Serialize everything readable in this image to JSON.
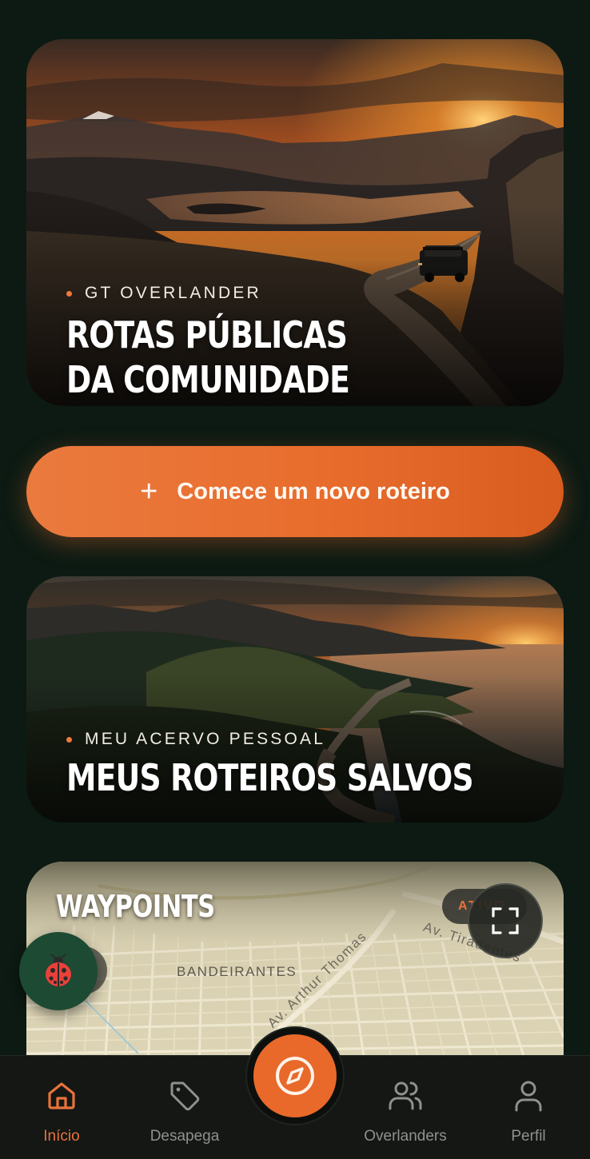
{
  "hero": {
    "eyebrow": "GT OVERLANDER",
    "title_line1": "ROTAS PÚBLICAS",
    "title_line2": "DA COMUNIDADE"
  },
  "cta": {
    "label": "Comece um novo roteiro",
    "icon": "plus-icon"
  },
  "saved": {
    "eyebrow": "MEU ACERVO PESSOAL",
    "title": "MEUS ROTEIROS SALVOS"
  },
  "waypoints": {
    "title": "WAYPOINTS",
    "status": "ATIVO",
    "streets": {
      "district": "BANDEIRANTES",
      "arthur": "Av. Arthur Thomas",
      "tiradentes": "Av. Tiradentes"
    }
  },
  "nav": {
    "items": [
      {
        "label": "Início",
        "icon": "home-icon",
        "active": true
      },
      {
        "label": "Desapega",
        "icon": "tag-icon",
        "active": false
      },
      {
        "label": "Overlanders",
        "icon": "users-icon",
        "active": false
      },
      {
        "label": "Perfil",
        "icon": "user-icon",
        "active": false
      }
    ],
    "center_icon": "compass-icon"
  },
  "colors": {
    "background": "#0c1a13",
    "accent": "#e8733a",
    "nav_bg": "#141714",
    "nav_inactive": "#8f918d"
  }
}
